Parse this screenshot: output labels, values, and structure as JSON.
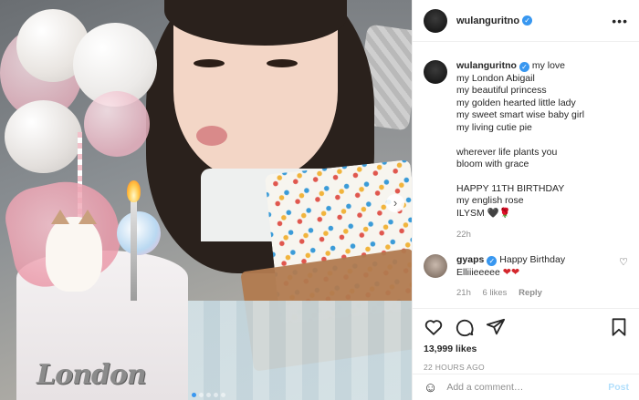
{
  "post": {
    "username": "wulanguritno",
    "caption_lines": [
      "my love",
      "my London Abigail",
      "my beautiful princess",
      "my golden hearted little lady",
      "my sweet smart wise baby girl",
      "my living cutie pie",
      "",
      "wherever life plants you",
      "bloom with grace",
      "",
      "HAPPY 11TH BIRTHDAY",
      "my english rose",
      "ILYSM 🖤🌹"
    ],
    "caption_age": "22h",
    "likes": "13,999 likes",
    "timestamp": "22 HOURS AGO",
    "cake_text": "London"
  },
  "comment": {
    "username": "gyaps",
    "text_line1": "Happy Birthday",
    "text_line2": "Elliiieeeee",
    "hearts": "❤❤",
    "age": "21h",
    "likes": "6 likes",
    "reply": "Reply"
  },
  "composer": {
    "placeholder": "Add a comment…",
    "post_label": "Post"
  },
  "icons": {
    "more": "more-options-icon",
    "like": "heart-icon",
    "comment": "comment-icon",
    "share": "share-icon",
    "save": "bookmark-icon",
    "emoji": "emoji-icon",
    "next": "chevron-right-icon"
  },
  "colors": {
    "verified": "#3897f0",
    "heart": "#d4262c",
    "post_button_disabled": "#b2dffc"
  },
  "carousel": {
    "slides": 5,
    "active": 1
  }
}
